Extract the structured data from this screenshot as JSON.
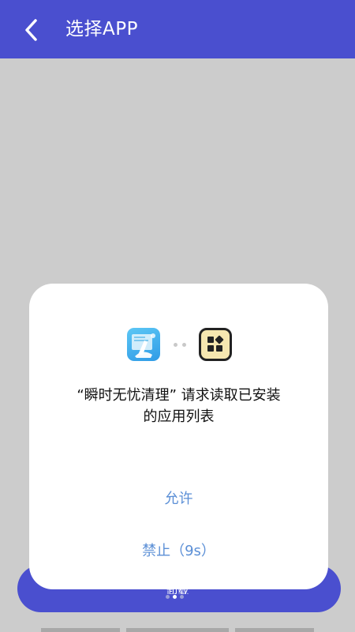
{
  "header": {
    "title": "选择APP",
    "back_icon": "chevron-left-icon"
  },
  "background_button": {
    "label": "卸载",
    "dots": 3
  },
  "dialog": {
    "source_app_icon": "cleaner-app-icon",
    "target_icon": "app-grid-icon",
    "message_line1": "“瞬时无忧清理” 请求读取已安装",
    "message_line2": "的应用列表",
    "allow_label": "允许",
    "deny_label": "禁止（9s）"
  },
  "colors": {
    "primary": "#4a4fcf",
    "overlay": "#cccccc",
    "dialog_button_text": "#5b8fd6"
  }
}
